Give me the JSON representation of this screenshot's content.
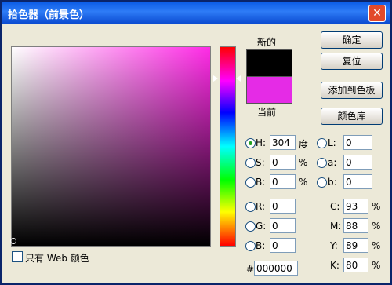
{
  "window": {
    "title": "拾色器（前景色）",
    "close_glyph": "✕"
  },
  "swatch": {
    "new_label": "新的",
    "current_label": "当前"
  },
  "buttons": {
    "ok": "确定",
    "reset": "复位",
    "add_to_swatches": "添加到色板",
    "color_libraries": "颜色库"
  },
  "hsb": {
    "h": {
      "label": "H:",
      "value": "304",
      "unit": "度"
    },
    "s": {
      "label": "S:",
      "value": "0",
      "unit": "%"
    },
    "b": {
      "label": "B:",
      "value": "0",
      "unit": "%"
    }
  },
  "rgb": {
    "r": {
      "label": "R:",
      "value": "0"
    },
    "g": {
      "label": "G:",
      "value": "0"
    },
    "b": {
      "label": "B:",
      "value": "0"
    }
  },
  "lab": {
    "l": {
      "label": "L:",
      "value": "0"
    },
    "a": {
      "label": "a:",
      "value": "0"
    },
    "b": {
      "label": "b:",
      "value": "0"
    }
  },
  "cmyk": {
    "c": {
      "label": "C:",
      "value": "93",
      "unit": "%"
    },
    "m": {
      "label": "M:",
      "value": "88",
      "unit": "%"
    },
    "y": {
      "label": "Y:",
      "value": "89",
      "unit": "%"
    },
    "k": {
      "label": "K:",
      "value": "80",
      "unit": "%"
    }
  },
  "hex": {
    "label": "#",
    "value": "000000"
  },
  "web_only": {
    "label": "只有 Web 颜色"
  },
  "colors": {
    "new": "#000000",
    "current": "#e52be6",
    "hue_base": "#ff2be6"
  }
}
